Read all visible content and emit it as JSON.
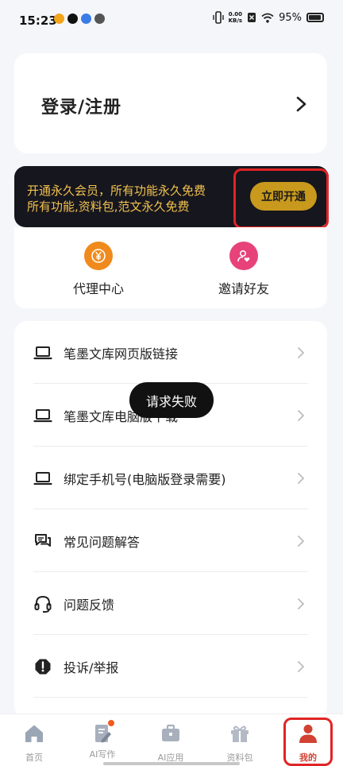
{
  "status_bar": {
    "time": "15:23",
    "net_speed_value": "0.00",
    "net_speed_unit": "KB/s",
    "battery": "95%"
  },
  "login": {
    "label": "登录/注册"
  },
  "vip": {
    "line1": "开通永久会员，所有功能永久免费",
    "line2": "所有功能,资料包,范文永久免费",
    "button_label": "立即开通"
  },
  "quick_actions": [
    {
      "label": "代理中心",
      "icon": "yen-icon",
      "glyph": "¥",
      "color": "#f08a1c"
    },
    {
      "label": "邀请好友",
      "icon": "user-heart-icon",
      "glyph": "♥",
      "color": "#e8427a"
    }
  ],
  "menu": [
    {
      "label": "笔墨文库网页版链接",
      "icon": "laptop-icon"
    },
    {
      "label": "笔墨文库电脑版下载",
      "icon": "laptop-icon"
    },
    {
      "label": "绑定手机号(电脑版登录需要)",
      "icon": "laptop-icon"
    },
    {
      "label": "常见问题解答",
      "icon": "chat-icon"
    },
    {
      "label": "问题反馈",
      "icon": "headset-icon"
    },
    {
      "label": "投诉/举报",
      "icon": "alert-icon"
    }
  ],
  "toast": {
    "text": "请求失败"
  },
  "tabs": [
    {
      "label": "首页",
      "icon": "home-icon"
    },
    {
      "label": "AI写作",
      "icon": "pen-doc-icon"
    },
    {
      "label": "AI应用",
      "icon": "briefcase-icon"
    },
    {
      "label": "资料包",
      "icon": "gift-icon"
    },
    {
      "label": "我的",
      "icon": "profile-icon"
    }
  ],
  "colors": {
    "accent_gold": "#c8991c",
    "vip_text": "#f2c14e",
    "active_tab": "#d24232",
    "highlight": "#e02424"
  }
}
